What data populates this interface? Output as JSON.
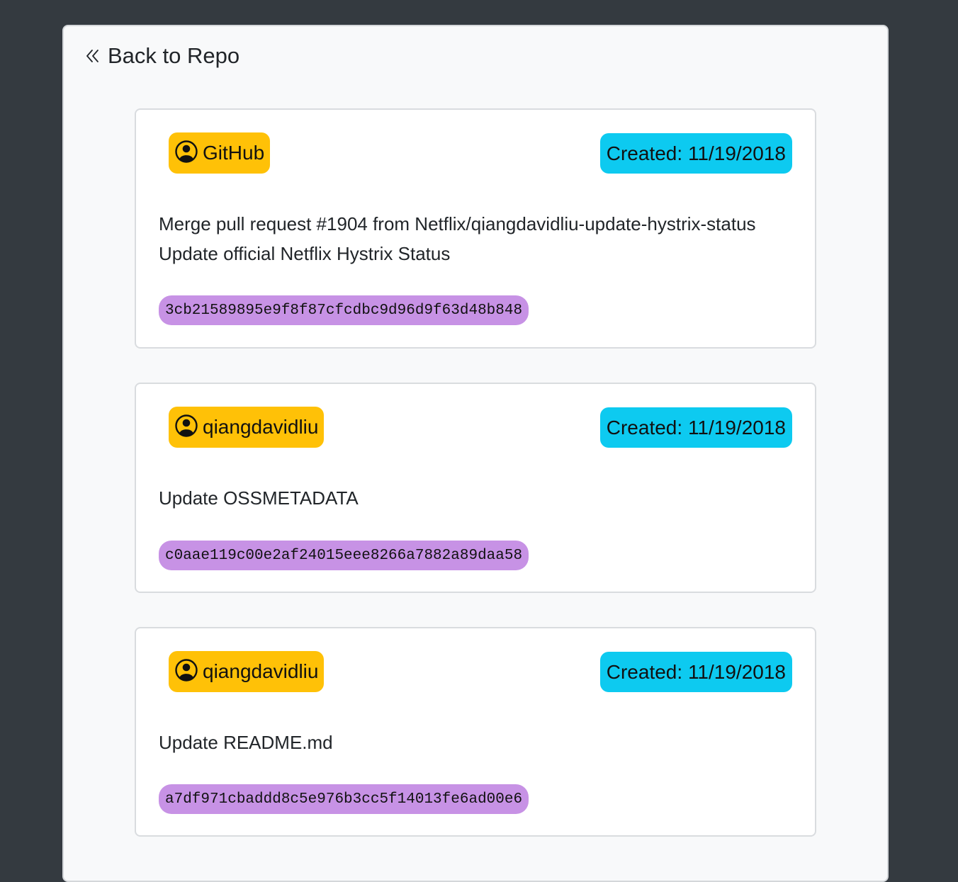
{
  "nav": {
    "back_label": "Back to Repo",
    "back_icon": "chevron-double-left-icon"
  },
  "colors": {
    "page_bg": "#343a40",
    "panel_bg": "#f8f9fa",
    "author_badge": "#ffc107",
    "date_badge": "#0dcaf0",
    "sha_badge": "#c792e5"
  },
  "commits": [
    {
      "author": "GitHub",
      "author_icon": "person-circle-icon",
      "created": "Created: 11/19/2018",
      "message": "Merge pull request #1904 from Netflix/qiangdavidliu-update-hystrix-status Update official Netflix Hystrix Status",
      "sha": "3cb21589895e9f8f87cfcdbc9d96d9f63d48b848"
    },
    {
      "author": "qiangdavidliu",
      "author_icon": "person-circle-icon",
      "created": "Created: 11/19/2018",
      "message": "Update OSSMETADATA",
      "sha": "c0aae119c00e2af24015eee8266a7882a89daa58"
    },
    {
      "author": "qiangdavidliu",
      "author_icon": "person-circle-icon",
      "created": "Created: 11/19/2018",
      "message": "Update README.md",
      "sha": "a7df971cbaddd8c5e976b3cc5f14013fe6ad00e6"
    }
  ]
}
